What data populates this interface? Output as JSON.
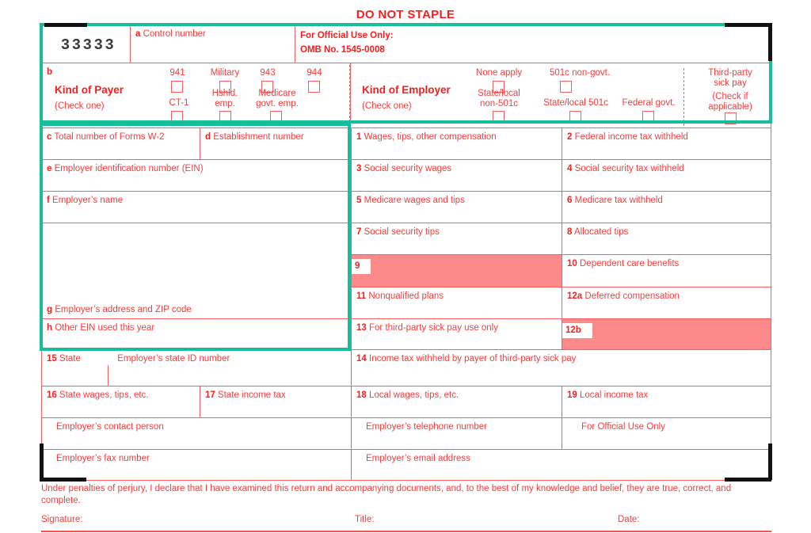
{
  "header": {
    "do_not_staple": "DO NOT STAPLE"
  },
  "control": {
    "value": "33333",
    "a_marker": "a",
    "a_label": "Control number",
    "official_use": "For Official Use Only:",
    "omb": "OMB No. 1545-0008"
  },
  "kind_of_payer": {
    "marker": "b",
    "title": "Kind of Payer",
    "subtitle": "(Check one)",
    "options": [
      {
        "label": "941",
        "checked": false
      },
      {
        "label": "Military",
        "checked": false
      },
      {
        "label": "943",
        "checked": false
      },
      {
        "label": "944",
        "checked": false
      },
      {
        "label": "CT-1",
        "checked": false
      },
      {
        "label": "Hshld.\nemp.",
        "checked": false
      },
      {
        "label": "Medicare\ngovt. emp.",
        "checked": false
      }
    ]
  },
  "kind_of_employer": {
    "title": "Kind of Employer",
    "subtitle": "(Check one)",
    "options": [
      {
        "label": "None apply",
        "checked": false
      },
      {
        "label": "501c non-govt.",
        "checked": false
      },
      {
        "label": "State/local\nnon-501c",
        "checked": false
      },
      {
        "label": "State/local 501c",
        "checked": false
      },
      {
        "label": "Federal govt.",
        "checked": false
      }
    ]
  },
  "third_party": {
    "title": "Third-party\nsick pay",
    "subtitle": "(Check if\napplicable)",
    "checked": false
  },
  "employer_boxes": {
    "c": {
      "marker": "c",
      "label": "Total number of Forms W-2",
      "value": ""
    },
    "d": {
      "marker": "d",
      "label": "Establishment number",
      "value": ""
    },
    "e": {
      "marker": "e",
      "label": "Employer identification number (EIN)",
      "value": ""
    },
    "f": {
      "marker": "f",
      "label": "Employer’s name",
      "value": ""
    },
    "g": {
      "marker": "g",
      "label": "Employer’s address and ZIP code",
      "value": ""
    },
    "h": {
      "marker": "h",
      "label": "Other EIN used this year",
      "value": ""
    }
  },
  "numbered_boxes": [
    {
      "num": "1",
      "label": "Wages, tips, other compensation",
      "value": "",
      "shaded": false
    },
    {
      "num": "2",
      "label": "Federal income tax withheld",
      "value": "",
      "shaded": false
    },
    {
      "num": "3",
      "label": "Social security wages",
      "value": "",
      "shaded": false
    },
    {
      "num": "4",
      "label": "Social security tax withheld",
      "value": "",
      "shaded": false
    },
    {
      "num": "5",
      "label": "Medicare wages and tips",
      "value": "",
      "shaded": false
    },
    {
      "num": "6",
      "label": "Medicare tax withheld",
      "value": "",
      "shaded": false
    },
    {
      "num": "7",
      "label": "Social security tips",
      "value": "",
      "shaded": false
    },
    {
      "num": "8",
      "label": "Allocated tips",
      "value": "",
      "shaded": false
    },
    {
      "num": "9",
      "label": "",
      "value": "",
      "shaded": true
    },
    {
      "num": "10",
      "label": "Dependent care benefits",
      "value": "",
      "shaded": false
    },
    {
      "num": "11",
      "label": "Nonqualified plans",
      "value": "",
      "shaded": false
    },
    {
      "num": "12a",
      "label": "Deferred compensation",
      "value": "",
      "shaded": false
    },
    {
      "num": "13",
      "label": "For third-party sick pay use only",
      "value": "",
      "shaded": false
    },
    {
      "num": "12b",
      "label": "",
      "value": "",
      "shaded": true
    }
  ],
  "state_boxes": {
    "b15_num": "15",
    "b15_label": "State",
    "b15_value": "",
    "b15_id_label": "Employer’s state ID number",
    "b15_id_value": "",
    "b14_num": "14",
    "b14_label": "Income tax withheld by payer of third-party sick pay",
    "b14_value": "",
    "b16_num": "16",
    "b16_label": "State wages, tips, etc.",
    "b16_value": "",
    "b17_num": "17",
    "b17_label": "State income tax",
    "b17_value": "",
    "b18_num": "18",
    "b18_label": "Local wages, tips, etc.",
    "b18_value": "",
    "b19_num": "19",
    "b19_label": "Local income tax",
    "b19_value": ""
  },
  "contact_boxes": {
    "contact_person": "Employer’s contact person",
    "contact_person_value": "",
    "telephone": "Employer’s telephone number",
    "telephone_value": "",
    "official_use": "For Official Use Only",
    "official_use_value": "",
    "fax": "Employer’s fax number",
    "fax_value": "",
    "email": "Employer’s email address",
    "email_value": ""
  },
  "footer": {
    "statement": "Under penalties of perjury, I declare that I have examined this return and accompanying documents, and, to the best of my knowledge and belief, they are true, correct, and complete.",
    "signature_label": "Signature:",
    "signature_value": "",
    "title_label": "Title:",
    "title_value": "",
    "date_label": "Date:",
    "date_value": ""
  },
  "colors": {
    "form_red": "#fc3b3b",
    "bold_red": "#fc1c1c",
    "rule_red": "#fb5e5e",
    "shade_pink": "#fc8a8a",
    "highlight_teal": "#16bf9a",
    "bracket_black": "#111111"
  }
}
